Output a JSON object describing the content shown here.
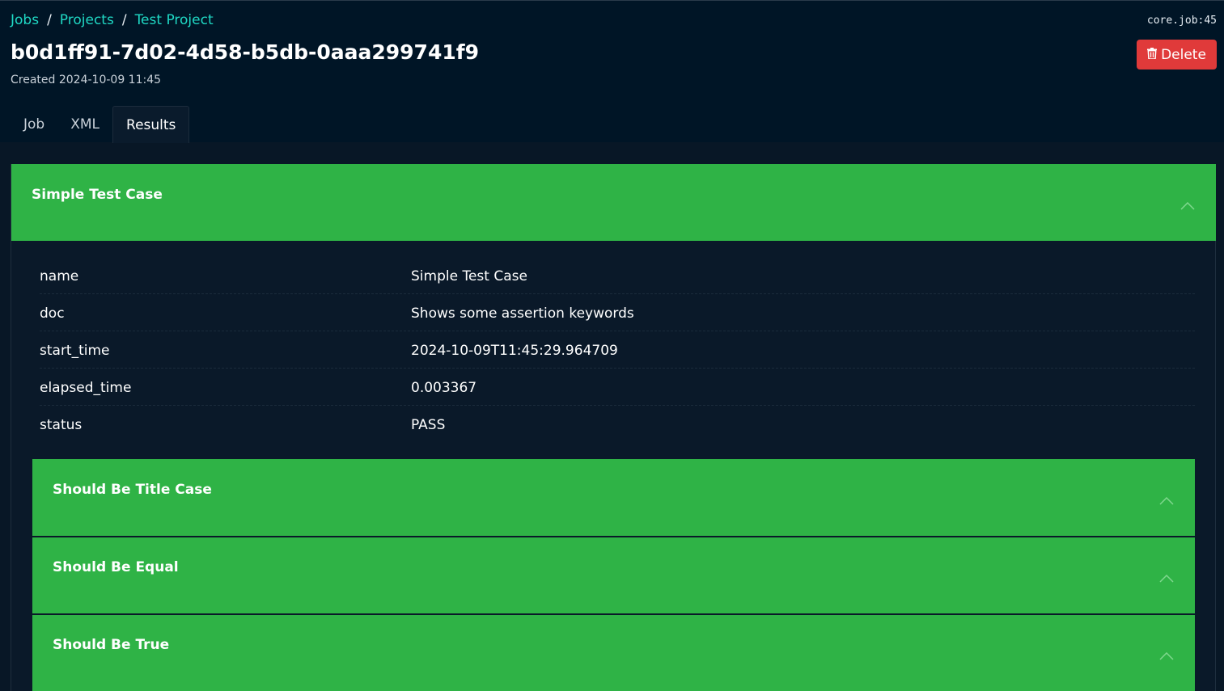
{
  "breadcrumb": {
    "items": [
      "Jobs",
      "Projects",
      "Test Project"
    ],
    "separator": "/"
  },
  "job_ref": "core.job:45",
  "page": {
    "title": "b0d1ff91-7d02-4d58-b5db-0aaa299741f9",
    "created_label": "Created",
    "created_value": "2024-10-09 11:45"
  },
  "actions": {
    "delete_label": "Delete",
    "delete_icon": "trash-icon"
  },
  "tabs": [
    {
      "label": "Job",
      "active": false
    },
    {
      "label": "XML",
      "active": false
    },
    {
      "label": "Results",
      "active": true
    }
  ],
  "test_case": {
    "header": "Simple Test Case",
    "fields": [
      {
        "key": "name",
        "value": "Simple Test Case"
      },
      {
        "key": "doc",
        "value": "Shows some assertion keywords"
      },
      {
        "key": "start_time",
        "value": "2024-10-09T11:45:29.964709"
      },
      {
        "key": "elapsed_time",
        "value": "0.003367"
      },
      {
        "key": "status",
        "value": "PASS"
      }
    ],
    "keywords": [
      {
        "label": "Should Be Title Case"
      },
      {
        "label": "Should Be Equal"
      },
      {
        "label": "Should Be True"
      }
    ]
  },
  "colors": {
    "background": "#081726",
    "header_bg": "#001526",
    "link": "#1fd8c4",
    "pass_green": "#2fb346",
    "danger": "#e03a3a"
  }
}
